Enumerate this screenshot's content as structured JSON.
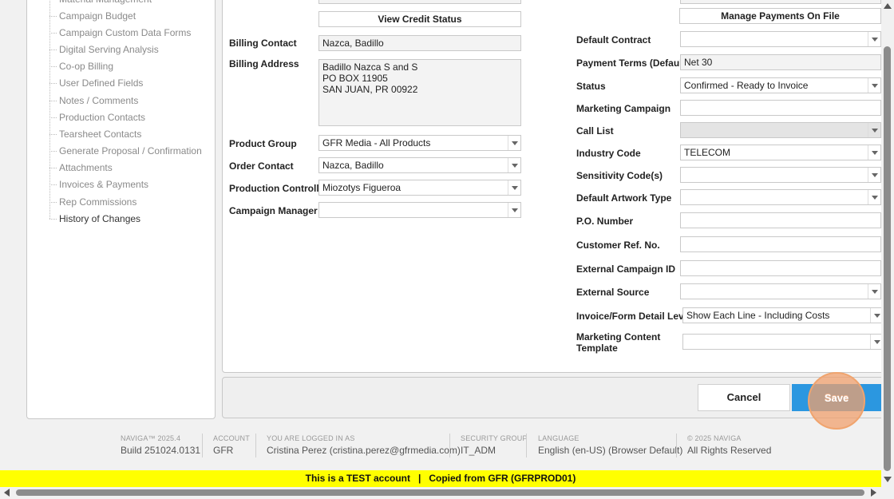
{
  "nav": {
    "items": [
      "Material Management",
      "Campaign Budget",
      "Campaign Custom Data Forms",
      "Digital Serving Analysis",
      "Co-op Billing",
      "User Defined Fields",
      "Notes / Comments",
      "Production Contacts",
      "Tearsheet Contacts",
      "Generate Proposal / Confirmation",
      "Attachments",
      "Invoices & Payments",
      "Rep Commissions",
      "History of Changes"
    ]
  },
  "left_form": {
    "view_credit_status": "View Credit Status",
    "billing_contact_label": "Billing Contact",
    "billing_contact_value": "Nazca, Badillo",
    "billing_address_label": "Billing Address",
    "billing_address_value": "Badillo Nazca S and S\nPO BOX 11905\nSAN JUAN, PR 00922",
    "product_group_label": "Product Group",
    "product_group_value": "GFR Media - All Products",
    "order_contact_label": "Order Contact",
    "order_contact_value": "Nazca, Badillo",
    "production_controller_label": "Production Controller",
    "production_controller_value": "Miozotys Figueroa",
    "campaign_manager_label": "Campaign Manager",
    "campaign_manager_value": ""
  },
  "right_form": {
    "manage_payments": "Manage Payments On File",
    "default_contract_label": "Default Contract",
    "default_contract_value": "",
    "payment_terms_label": "Payment Terms (Default)",
    "payment_terms_value": "Net 30",
    "status_label": "Status",
    "status_value": "Confirmed - Ready to Invoice",
    "marketing_campaign_label": "Marketing Campaign",
    "marketing_campaign_value": "",
    "call_list_label": "Call List",
    "call_list_value": "",
    "industry_code_label": "Industry Code",
    "industry_code_value": "TELECOM",
    "sensitivity_codes_label": "Sensitivity Code(s)",
    "sensitivity_codes_value": "",
    "default_artwork_label": "Default Artwork Type",
    "default_artwork_value": "",
    "po_number_label": "P.O. Number",
    "po_number_value": "",
    "customer_ref_label": "Customer Ref. No.",
    "customer_ref_value": "",
    "external_campaign_label": "External Campaign ID",
    "external_campaign_value": "",
    "external_source_label": "External Source",
    "external_source_value": "",
    "invoice_detail_label": "Invoice/Form Detail Level",
    "invoice_detail_value": "Show Each Line - Including Costs",
    "marketing_content_label_1": "Marketing Content",
    "marketing_content_label_2": "Template",
    "marketing_content_value": ""
  },
  "actions": {
    "cancel": "Cancel",
    "save": "Save"
  },
  "footer": {
    "product_cap": "NAVIGA™ 2025.4",
    "product_val": "Build 251024.0131",
    "account_cap": "ACCOUNT",
    "account_val": "GFR",
    "login_cap": "YOU ARE LOGGED IN AS",
    "login_val": "Cristina Perez (cristina.perez@gfrmedia.com)",
    "security_cap": "SECURITY GROUP",
    "security_val": "IT_ADM",
    "language_cap": "LANGUAGE",
    "language_val": "English (en-US) (Browser Default)",
    "copyright_cap": "© 2025 NAVIGA",
    "copyright_val": "All Rights Reserved"
  },
  "banner": "This is a TEST account   |   Copied from GFR (GFRPROD01)",
  "colors": {
    "save_button": "#2b97e0",
    "banner": "#ffff00",
    "click_highlight": "#f0a46e"
  }
}
